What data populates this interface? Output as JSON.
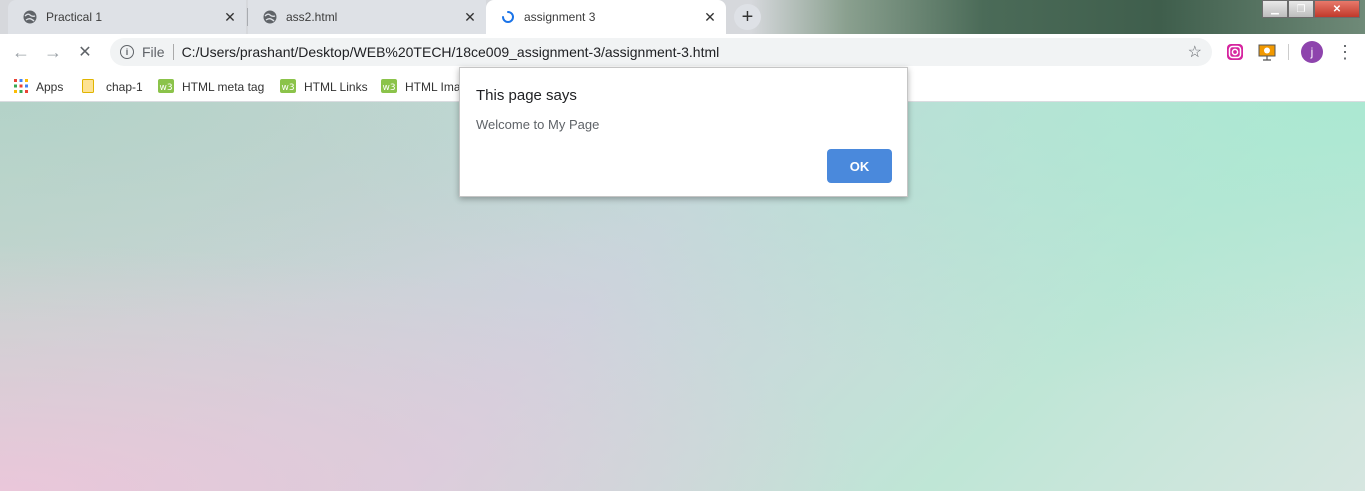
{
  "tabs": [
    {
      "title": "Practical 1",
      "icon": "globe-icon",
      "active": false
    },
    {
      "title": "ass2.html",
      "icon": "globe-icon",
      "active": false
    },
    {
      "title": "assignment 3",
      "icon": "loading-spinner-icon",
      "active": true
    }
  ],
  "toolbar": {
    "back_icon": "arrow-left-icon",
    "forward_icon": "arrow-right-icon",
    "stop_icon": "close-icon",
    "scheme_label": "File",
    "url": "C:/Users/prashant/Desktop/WEB%20TECH/18ce009_assignment-3/assignment-3.html",
    "profile_initial": "j"
  },
  "bookmarks": [
    {
      "label": "Apps",
      "icon": "apps-grid-icon"
    },
    {
      "label": "chap-1",
      "icon": "folder-icon"
    },
    {
      "label": "HTML meta tag",
      "icon": "w3-logo-icon"
    },
    {
      "label": "HTML Links",
      "icon": "w3-logo-icon"
    },
    {
      "label": "HTML Ima",
      "icon": "w3-logo-icon"
    }
  ],
  "dialog": {
    "title": "This page says",
    "message": "Welcome to My Page",
    "ok_label": "OK"
  },
  "colors": {
    "accent": "#4a89dc",
    "profile_avatar": "#8e44ad"
  }
}
